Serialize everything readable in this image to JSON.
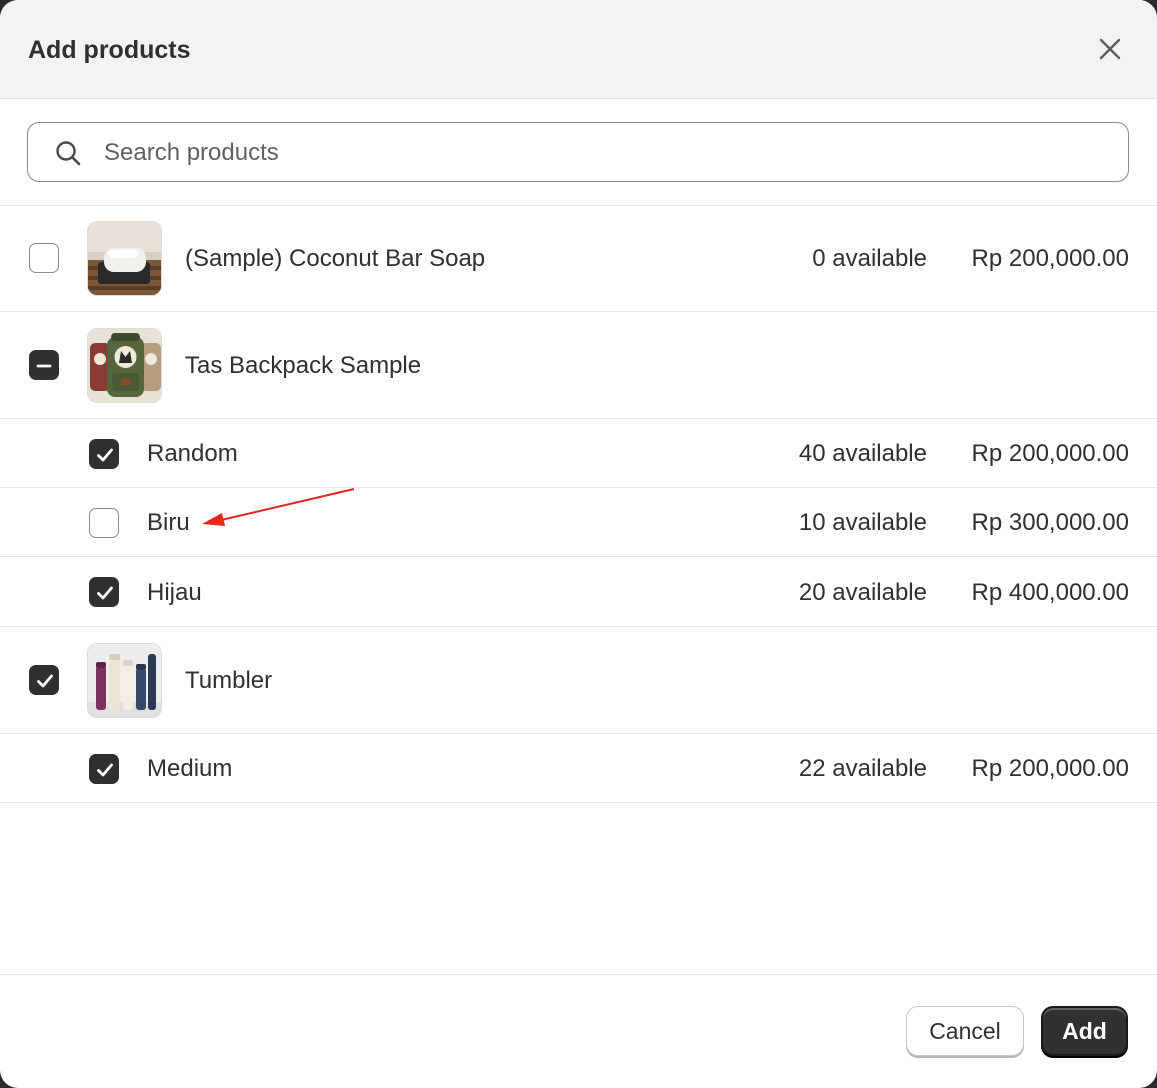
{
  "dialog": {
    "title": "Add products"
  },
  "search": {
    "placeholder": "Search products",
    "value": ""
  },
  "products": [
    {
      "name": "(Sample) Coconut Bar Soap",
      "state": "unchecked",
      "available": "0 available",
      "price": "Rp 200,000.00",
      "thumbnail": "soap-image"
    },
    {
      "name": "Tas Backpack Sample",
      "state": "indeterminate",
      "thumbnail": "backpack-image",
      "variants": [
        {
          "name": "Random",
          "state": "checked",
          "available": "40 available",
          "price": "Rp 200,000.00"
        },
        {
          "name": "Biru",
          "state": "unchecked",
          "available": "10 available",
          "price": "Rp 300,000.00"
        },
        {
          "name": "Hijau",
          "state": "checked",
          "available": "20 available",
          "price": "Rp 400,000.00"
        }
      ]
    },
    {
      "name": "Tumbler",
      "state": "checked",
      "thumbnail": "tumbler-image",
      "variants": [
        {
          "name": "Medium",
          "state": "checked",
          "available": "22 available",
          "price": "Rp 200,000.00"
        }
      ]
    }
  ],
  "footer": {
    "cancel_label": "Cancel",
    "add_label": "Add"
  },
  "annotation": {
    "arrow_color": "#e8261c"
  },
  "colors": {
    "primary": "#303030",
    "header_bg": "#f3f3f3"
  }
}
